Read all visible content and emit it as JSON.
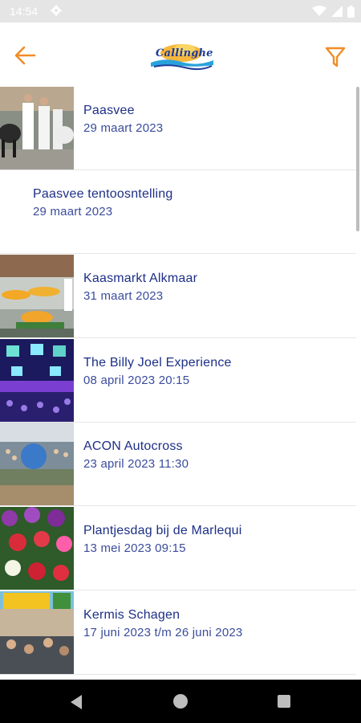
{
  "status_bar": {
    "time": "14:54"
  },
  "app_bar": {
    "logo_text": "Callinghe",
    "colors": {
      "accent": "#f28c28",
      "logo_blue": "#1f3c9a"
    }
  },
  "events": [
    {
      "title": "Paasvee",
      "date": "29 maart 2023",
      "has_image": true,
      "image": "cattle-show-photo"
    },
    {
      "title": "Paasvee tentoosntelling",
      "date": "29 maart 2023",
      "has_image": false
    },
    {
      "title": "Kaasmarkt Alkmaar",
      "date": "31 maart 2023",
      "has_image": true,
      "image": "cheese-market-photo"
    },
    {
      "title": "The Billy Joel Experience",
      "date": "08 april 2023 20:15",
      "has_image": true,
      "image": "concert-stage-photo"
    },
    {
      "title": "ACON Autocross",
      "date": "23 april 2023 11:30",
      "has_image": true,
      "image": "autocross-crowd-photo"
    },
    {
      "title": "Plantjesdag bij de Marlequi",
      "date": "13 mei 2023 09:15",
      "has_image": true,
      "image": "flowers-photo"
    },
    {
      "title": "Kermis Schagen",
      "date": "17 juni 2023 t/m 26 juni 2023",
      "has_image": true,
      "image": "funfair-photo"
    }
  ]
}
